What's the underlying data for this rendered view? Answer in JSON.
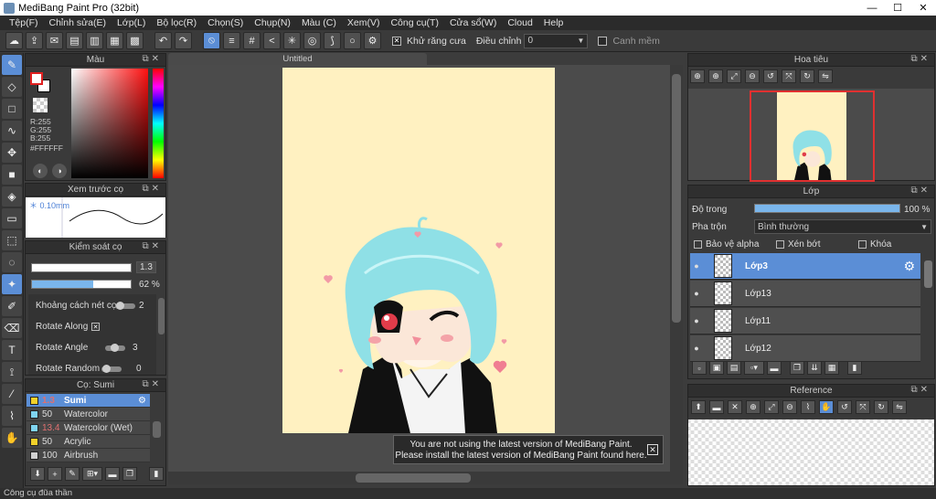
{
  "window": {
    "title": "MediBang Paint Pro (32bit)",
    "minimize": "—",
    "maximize": "☐",
    "close": "✕"
  },
  "menu": [
    "Tệp(F)",
    "Chỉnh sửa(E)",
    "Lớp(L)",
    "Bộ lọc(R)",
    "Chọn(S)",
    "Chụp(N)",
    "Màu (C)",
    "Xem(V)",
    "Công cụ(T)",
    "Cửa sổ(W)",
    "Cloud",
    "Help"
  ],
  "toolbar": {
    "antialias_label": "Khử răng cưa",
    "antialias_checked": "✕",
    "correction_label": "Điều chỉnh",
    "correction_value": "0",
    "smooth_label": "Canh mềm"
  },
  "color_panel": {
    "title": "Màu",
    "r": "R:255",
    "g": "G:255",
    "b": "B:255",
    "hex": "#FFFFFF",
    "foreground": "#ffffff",
    "background": "#ffffff"
  },
  "preview_panel": {
    "title": "Xem trước cọ",
    "size": "0.10mm"
  },
  "brush_control": {
    "title": "Kiểm soát cọ",
    "size_value": "1.3",
    "opacity_value": "62 %",
    "opacity_fraction": 0.62,
    "spacing_label": "Khoảng cách nét cọ",
    "spacing_value": "2",
    "rotate_along_label": "Rotate Along",
    "rotate_along_checked": "✕",
    "rotate_angle_label": "Rotate Angle",
    "rotate_angle_value": "3",
    "rotate_random_label": "Rotate Random",
    "rotate_random_value": "0"
  },
  "brush_list": {
    "title": "Cọ: Sumi",
    "items": [
      {
        "size": "1.3",
        "name": "Sumi",
        "color": "#f2d12a",
        "selected": true,
        "red": true
      },
      {
        "size": "50",
        "name": "Watercolor",
        "color": "#7fd4f0",
        "selected": false,
        "red": false
      },
      {
        "size": "13.4",
        "name": "Watercolor (Wet)",
        "color": "#7fd4f0",
        "selected": false,
        "red": true
      },
      {
        "size": "50",
        "name": "Acrylic",
        "color": "#f2d12a",
        "selected": false,
        "red": false
      },
      {
        "size": "100",
        "name": "Airbrush",
        "color": "#d0d0d0",
        "selected": false,
        "red": false
      }
    ]
  },
  "document": {
    "tab_title": "Untitled"
  },
  "notice": {
    "line1": "You are not using the latest version of MediBang Paint.",
    "line2": "Please install the latest version of MediBang Paint found here.",
    "close": "✕"
  },
  "navigator": {
    "title": "Hoa tiêu"
  },
  "layers": {
    "title": "Lớp",
    "opacity_label": "Độ trong",
    "opacity_value": "100 %",
    "opacity_fraction": 1.0,
    "blend_label": "Pha trộn",
    "blend_value": "Bình thường",
    "protect_alpha": "Bảo vệ alpha",
    "clipping": "Xén bớt",
    "lock": "Khóa",
    "items": [
      {
        "name": "Lớp3",
        "selected": true
      },
      {
        "name": "Lớp13",
        "selected": false
      },
      {
        "name": "Lớp11",
        "selected": false
      },
      {
        "name": "Lớp12",
        "selected": false
      }
    ]
  },
  "reference": {
    "title": "Reference"
  },
  "status": {
    "text": "Công cụ đũa thần"
  }
}
